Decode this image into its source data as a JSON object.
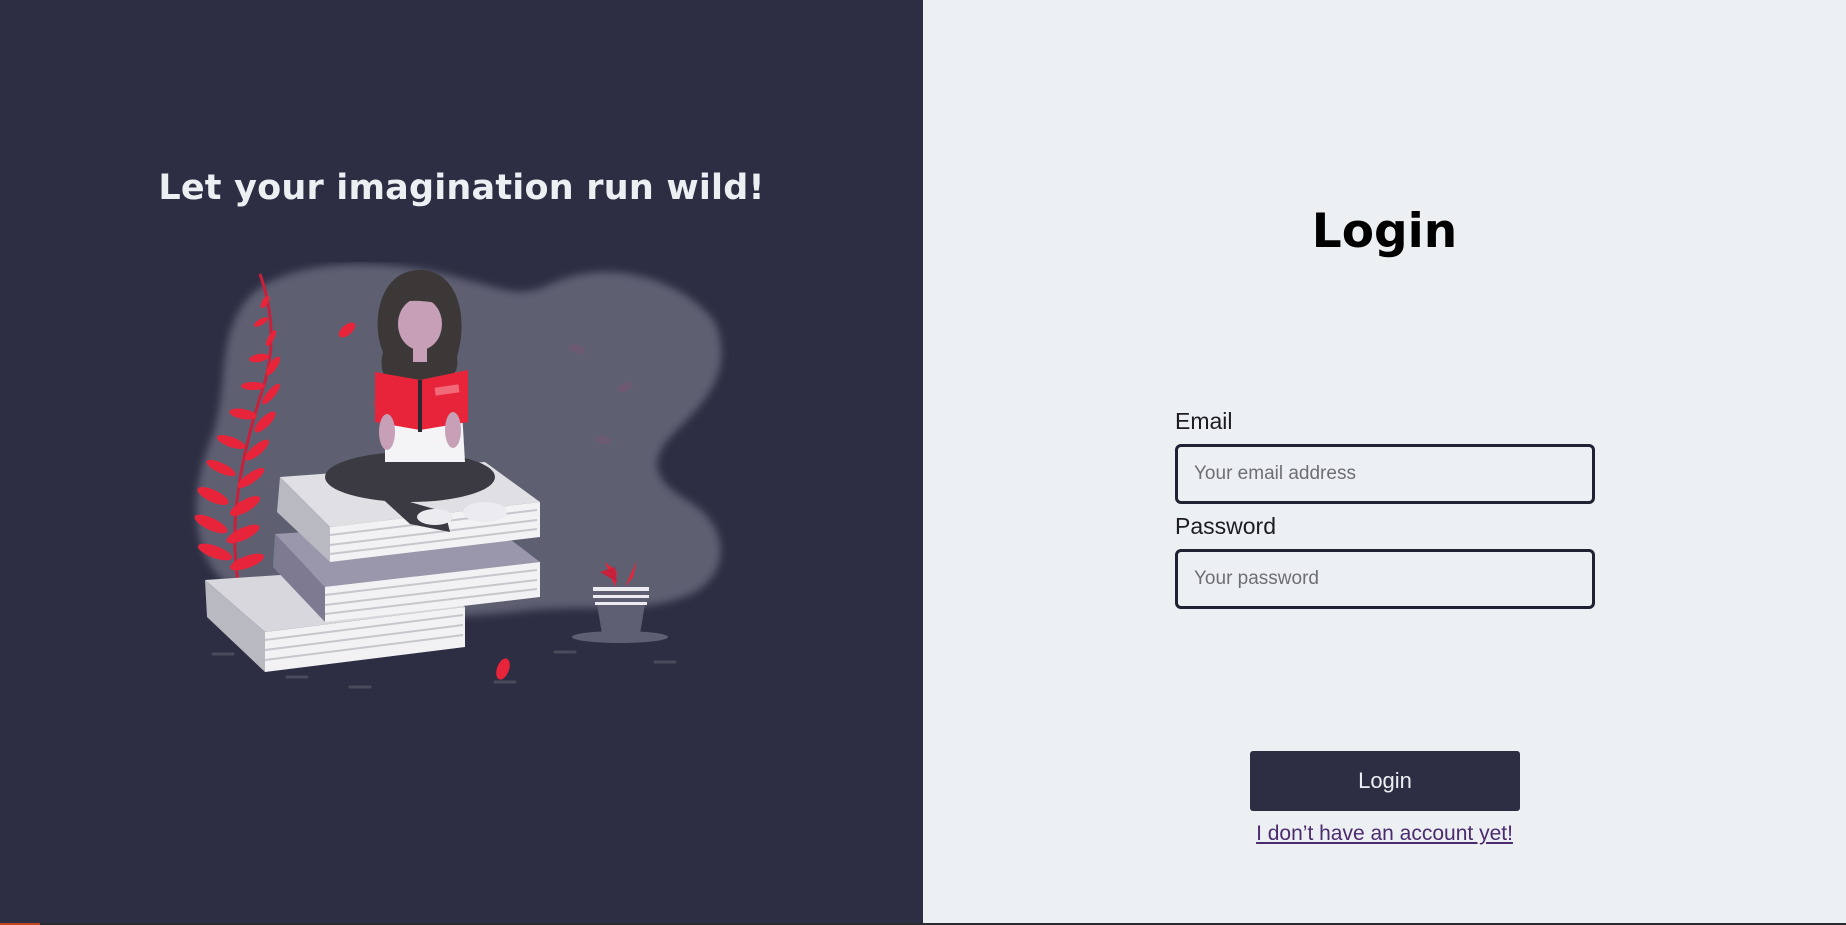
{
  "hero": {
    "title": "Let your imagination run wild!",
    "illustration": "woman-reading-on-books-illustration"
  },
  "login": {
    "title": "Login",
    "email_label": "Email",
    "email_placeholder": "Your email address",
    "email_value": "",
    "password_label": "Password",
    "password_placeholder": "Your password",
    "password_value": "",
    "submit_label": "Login",
    "signup_link": "I don’t have an account yet!"
  },
  "colors": {
    "dark_panel": "#2d2e43",
    "light_panel": "#ecf0f3",
    "accent_red": "#e8243a",
    "link": "#4b2a6e"
  }
}
